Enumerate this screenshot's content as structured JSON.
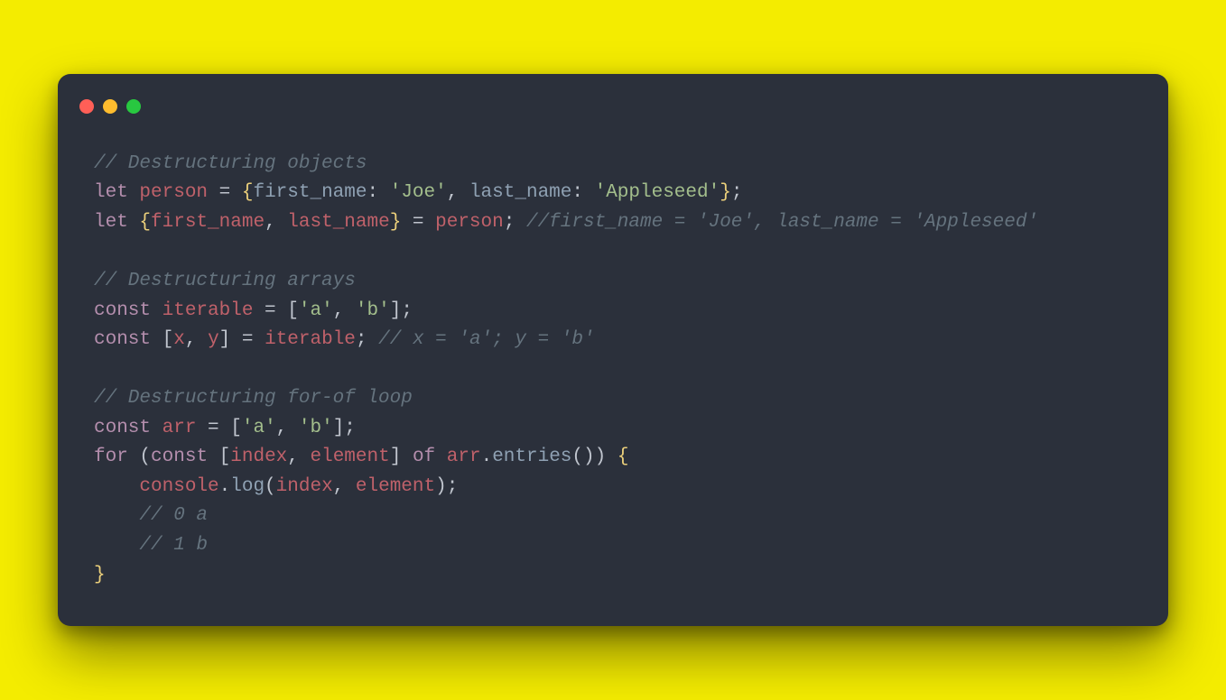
{
  "window": {
    "traffic_lights": [
      "red",
      "yellow",
      "green"
    ]
  },
  "code": {
    "l1_comment": "// Destructuring objects",
    "l2_let": "let",
    "l2_person": "person",
    "l2_eq": " = ",
    "l2_fn_key": "first_name",
    "l2_colon1": ": ",
    "l2_joe": "'Joe'",
    "l2_comma1": ", ",
    "l2_ln_key": "last_name",
    "l2_colon2": ": ",
    "l2_apple": "'Appleseed'",
    "l2_semi": ";",
    "l3_let": "let",
    "l3_fn": "first_name",
    "l3_comma": ", ",
    "l3_ln": "last_name",
    "l3_eq": " = ",
    "l3_person": "person",
    "l3_semi": "; ",
    "l3_comment": "//first_name = 'Joe', last_name = 'Appleseed'",
    "l5_comment": "// Destructuring arrays",
    "l6_const": "const",
    "l6_iterable": "iterable",
    "l6_eq": " = [",
    "l6_a": "'a'",
    "l6_comma": ", ",
    "l6_b": "'b'",
    "l6_close": "];",
    "l7_const": "const",
    "l7_open": " [",
    "l7_x": "x",
    "l7_comma": ", ",
    "l7_y": "y",
    "l7_close": "] = ",
    "l7_iterable": "iterable",
    "l7_semi": "; ",
    "l7_comment": "// x = 'a'; y = 'b'",
    "l9_comment": "// Destructuring for-of loop",
    "l10_const": "const",
    "l10_arr": "arr",
    "l10_eq": " = [",
    "l10_a": "'a'",
    "l10_comma": ", ",
    "l10_b": "'b'",
    "l10_close": "];",
    "l11_for": "for",
    "l11_open": " (",
    "l11_const": "const",
    "l11_br_open": " [",
    "l11_index": "index",
    "l11_comma": ", ",
    "l11_element": "element",
    "l11_br_close": "] ",
    "l11_of": "of",
    "l11_sp": " ",
    "l11_arr": "arr",
    "l11_dot": ".",
    "l11_entries": "entries",
    "l11_call": "()) ",
    "l11_brace": "{",
    "l12_console": "console",
    "l12_dot": ".",
    "l12_log": "log",
    "l12_open": "(",
    "l12_index": "index",
    "l12_comma": ", ",
    "l12_element": "element",
    "l12_close": ");",
    "l13_comment": "// 0 a",
    "l14_comment": "// 1 b",
    "l15_brace": "}"
  }
}
